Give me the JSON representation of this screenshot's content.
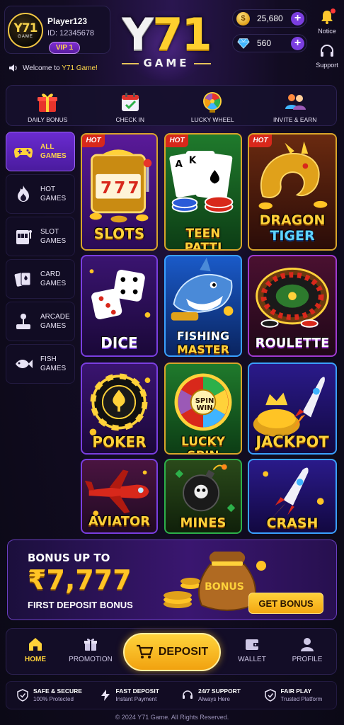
{
  "profile": {
    "username": "Player123",
    "user_id": "ID: 12345678",
    "vip_level": "VIP 1",
    "avatar_logo_text": "Y71",
    "avatar_logo_sub": "GAME"
  },
  "brand": {
    "logo_main_y": "Y",
    "logo_main_num": "71",
    "logo_sub": "GAME"
  },
  "currency": {
    "coins": "25,680",
    "gems": "560",
    "coin_symbol": "$",
    "add_label": "+"
  },
  "header_actions": {
    "notice": "Notice",
    "support": "Support"
  },
  "welcome": {
    "prefix": "Welcome to ",
    "highlight": "Y71 Game!"
  },
  "quick_actions": [
    {
      "label": "DAILY BONUS",
      "icon": "gift-icon"
    },
    {
      "label": "CHECK IN",
      "icon": "calendar-check-icon"
    },
    {
      "label": "LUCKY WHEEL",
      "icon": "wheel-icon"
    },
    {
      "label": "INVITE & EARN",
      "icon": "users-icon"
    }
  ],
  "categories": [
    {
      "line1": "ALL",
      "line2": "GAMES",
      "icon": "gamepad-icon",
      "active": true
    },
    {
      "line1": "HOT",
      "line2": "GAMES",
      "icon": "flame-icon",
      "active": false
    },
    {
      "line1": "SLOT",
      "line2": "GAMES",
      "icon": "slot-machine-icon",
      "active": false
    },
    {
      "line1": "CARD",
      "line2": "GAMES",
      "icon": "cards-icon",
      "active": false
    },
    {
      "line1": "ARCADE",
      "line2": "GAMES",
      "icon": "joystick-icon",
      "active": false
    },
    {
      "line1": "FISH",
      "line2": "GAMES",
      "icon": "fish-icon",
      "active": false
    }
  ],
  "hot_label": "HOT",
  "games": [
    {
      "name": "SLOTS",
      "hot": true
    },
    {
      "name": "TEEN PATTI",
      "hot": true
    },
    {
      "name": "DRAGON",
      "name2": "TIGER",
      "hot": true
    },
    {
      "name": "DICE",
      "hot": false
    },
    {
      "name": "FISHING",
      "name2": "MASTER",
      "hot": false
    },
    {
      "name": "ROULETTE",
      "hot": false
    },
    {
      "name": "POKER",
      "hot": false
    },
    {
      "name": "LUCKY SPIN",
      "hot": false,
      "art_text": "SPIN WIN"
    },
    {
      "name": "JACKPOT",
      "hot": false
    },
    {
      "name": "AVIATOR",
      "hot": false
    },
    {
      "name": "MINES",
      "hot": false
    },
    {
      "name": "CRASH",
      "hot": false
    }
  ],
  "banner": {
    "line1": "BONUS UP TO",
    "amount": "₹7,777",
    "line3": "FIRST DEPOSIT BONUS",
    "bag_text": "BONUS",
    "cta": "GET BONUS"
  },
  "bottom_nav": {
    "home": "HOME",
    "promotion": "PROMOTION",
    "deposit": "DEPOSIT",
    "wallet": "WALLET",
    "profile": "PROFILE"
  },
  "trust": [
    {
      "title": "SAFE & SECURE",
      "sub": "100% Protected",
      "icon": "shield-check-icon"
    },
    {
      "title": "FAST DEPOSIT",
      "sub": "Instant Payment",
      "icon": "lightning-icon"
    },
    {
      "title": "24/7 SUPPORT",
      "sub": "Always Here",
      "icon": "headset-icon"
    },
    {
      "title": "FAIR PLAY",
      "sub": "Trusted Platform",
      "icon": "shield-check-icon"
    }
  ],
  "footer": "© 2024 Y71 Game. All Rights Reserved.",
  "colors": {
    "accent_gold": "#ffd23a",
    "accent_purple": "#6a2bd0",
    "background": "#0d0a1a",
    "hot_badge": "#d8281b",
    "notification_dot": "#ff3838"
  }
}
